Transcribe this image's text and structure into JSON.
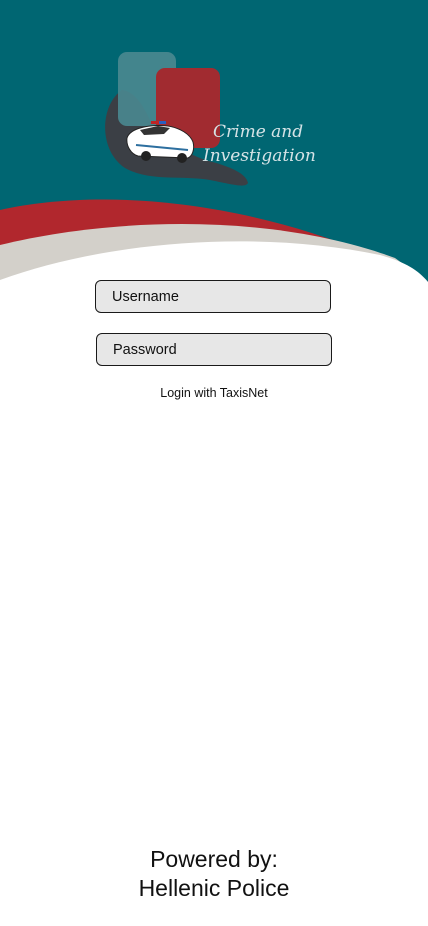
{
  "app": {
    "logo_line1": "Crime and",
    "logo_line2": "Investigation"
  },
  "colors": {
    "header_teal": "#006672",
    "accent_red": "#b1272d",
    "swoosh_gray": "#d3d0ca"
  },
  "icons": {
    "logo": "police-car-logo-icon"
  },
  "login": {
    "username_placeholder": "Username",
    "password_placeholder": "Password",
    "taxisnet_label": "Login with TaxisNet"
  },
  "footer": {
    "line1": "Powered by:",
    "line2": "Hellenic Police"
  }
}
